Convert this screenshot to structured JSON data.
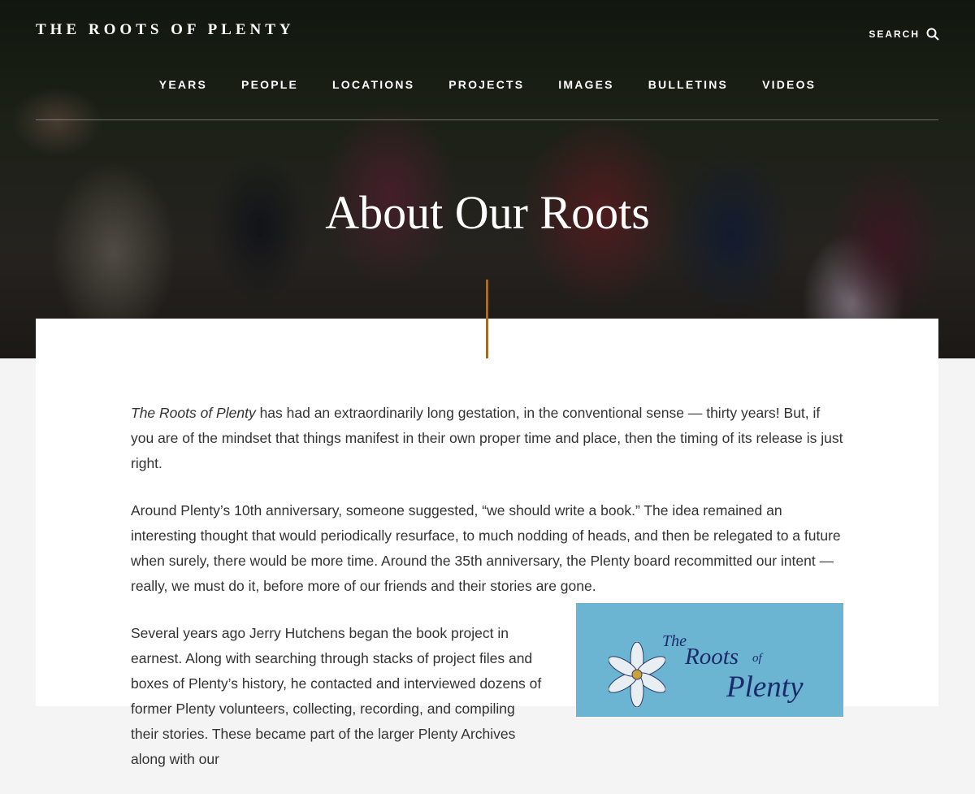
{
  "brand": "THE ROOTS OF PLENTY",
  "search": {
    "label": "SEARCH"
  },
  "nav": [
    "YEARS",
    "PEOPLE",
    "LOCATIONS",
    "PROJECTS",
    "IMAGES",
    "BULLETINS",
    "VIDEOS"
  ],
  "hero": {
    "title": "About Our Roots"
  },
  "article": {
    "p1_em": "The Roots of Plenty",
    "p1_rest": " has had an extraordinarily long gestation, in the conventional sense — thirty years! But, if you are of the mindset that things manifest in their own proper time and place, then the timing of its release is just right.",
    "p2": "Around Plenty’s 10th anniversary, someone suggested, “we should write a book.” The idea remained an interesting thought that would periodically resurface, to much nodding of heads, and then be relegated to a future when surely, there would be more time. Around the 35th anniversary, the Plenty board recommitted our intent — really, we must do it, before more of our friends and their stories are gone.",
    "p3": "Several years ago Jerry Hutchens began the book project in earnest. Along with searching through stacks of project files and boxes of Plenty’s history, he contacted and interviewed dozens of former Plenty volunteers, collecting, recording, and compiling their stories. These became part of the larger Plenty Archives along with our"
  },
  "cover": {
    "the": "The",
    "roots": "Roots",
    "of": "of",
    "plenty": "Plenty"
  },
  "colors": {
    "accent": "#a36a28",
    "cover_bg": "#6bb5d3",
    "cover_text": "#1b2a6b"
  }
}
